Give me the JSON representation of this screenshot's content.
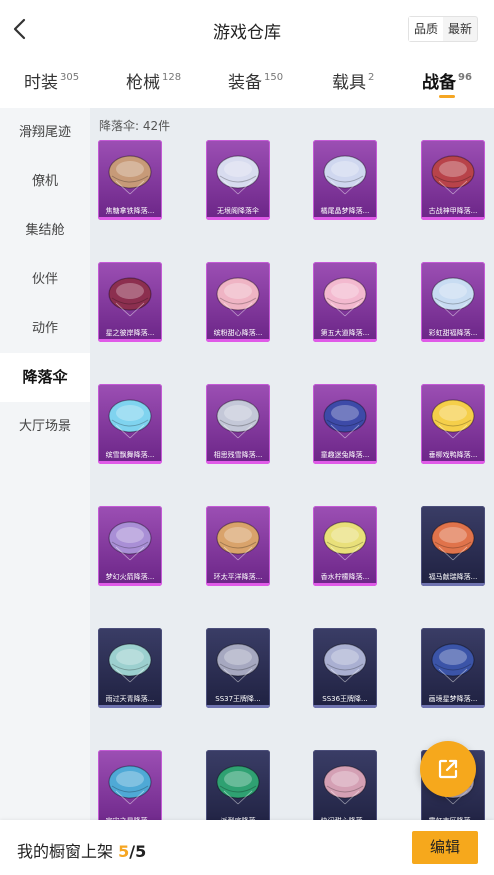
{
  "header": {
    "title": "游戏仓库",
    "back_icon": "chevron-left-icon",
    "sort_options": [
      "品质",
      "最新"
    ],
    "sort_selected": "品质"
  },
  "tabs": [
    {
      "label": "时装",
      "count": "305"
    },
    {
      "label": "枪械",
      "count": "128"
    },
    {
      "label": "装备",
      "count": "150"
    },
    {
      "label": "载具",
      "count": "2"
    },
    {
      "label": "战备",
      "count": "96",
      "active": true
    }
  ],
  "sidebar": {
    "items": [
      "滑翔尾迹",
      "僚机",
      "集结舱",
      "伙伴",
      "动作",
      "降落伞",
      "大厅场景"
    ],
    "selected": "降落伞"
  },
  "content": {
    "count_label": "降落伞: 42件",
    "items": [
      {
        "name": "焦糖拿铁降落...",
        "rarity": "purple",
        "color": "#c79a78"
      },
      {
        "name": "无垠阁降落伞",
        "rarity": "purple",
        "color": "#d8dcef"
      },
      {
        "name": "橘尾晶梦降落...",
        "rarity": "purple",
        "color": "#cfd7ef"
      },
      {
        "name": "古战神甲降落...",
        "rarity": "purple",
        "color": "#b8434a"
      },
      {
        "name": "星之彼岸降落...",
        "rarity": "purple",
        "color": "#8c2f4f"
      },
      {
        "name": "缤粉甜心降落...",
        "rarity": "purple",
        "color": "#efb4c4"
      },
      {
        "name": "第五大道降落...",
        "rarity": "purple",
        "color": "#f3b9cf"
      },
      {
        "name": "彩虹甜福降落...",
        "rarity": "purple",
        "color": "#c8dcf2"
      },
      {
        "name": "缤雪飘舞降落...",
        "rarity": "purple",
        "color": "#7fd3ef"
      },
      {
        "name": "相思残雪降落...",
        "rarity": "purple",
        "color": "#c4c8d8"
      },
      {
        "name": "童趣迷兔降落...",
        "rarity": "purple",
        "color": "#3d4aa8"
      },
      {
        "name": "垂柳戏鸭降落...",
        "rarity": "purple",
        "color": "#f5cf4a"
      },
      {
        "name": "梦幻火箭降落...",
        "rarity": "purple",
        "color": "#a98fd6"
      },
      {
        "name": "环太平洋降落...",
        "rarity": "purple",
        "color": "#d9a36b"
      },
      {
        "name": "香水柠檬降落...",
        "rarity": "purple",
        "color": "#e9e07a"
      },
      {
        "name": "福马献瑞降落...",
        "rarity": "navy",
        "color": "#e0734b"
      },
      {
        "name": "雨过天青降落...",
        "rarity": "navy",
        "color": "#9cd0cf"
      },
      {
        "name": "SS37王牌降...",
        "rarity": "navy",
        "color": "#a6a8c0"
      },
      {
        "name": "SS36王牌降...",
        "rarity": "navy",
        "color": "#aab0d2"
      },
      {
        "name": "画境星梦降落...",
        "rarity": "navy",
        "color": "#3b54a8"
      },
      {
        "name": "宇宙之星降落...",
        "rarity": "purple",
        "color": "#4fa9d6"
      },
      {
        "name": "一派到底降落...",
        "rarity": "navy",
        "color": "#2fa172"
      },
      {
        "name": "快闪甜心降落...",
        "rarity": "navy",
        "color": "#d4a0b4"
      },
      {
        "name": "霓虹市区降落...",
        "rarity": "navy",
        "color": "#b8b0cc"
      }
    ]
  },
  "fab": {
    "icon": "share-external-icon",
    "color": "#f6a81c"
  },
  "footer": {
    "label": "我的橱窗上架",
    "current": "5",
    "total": "/5",
    "edit_label": "编辑"
  },
  "colors": {
    "accent": "#f6a81c",
    "sidebar_bg": "#f3f5f7",
    "content_bg": "#e9edf1"
  }
}
